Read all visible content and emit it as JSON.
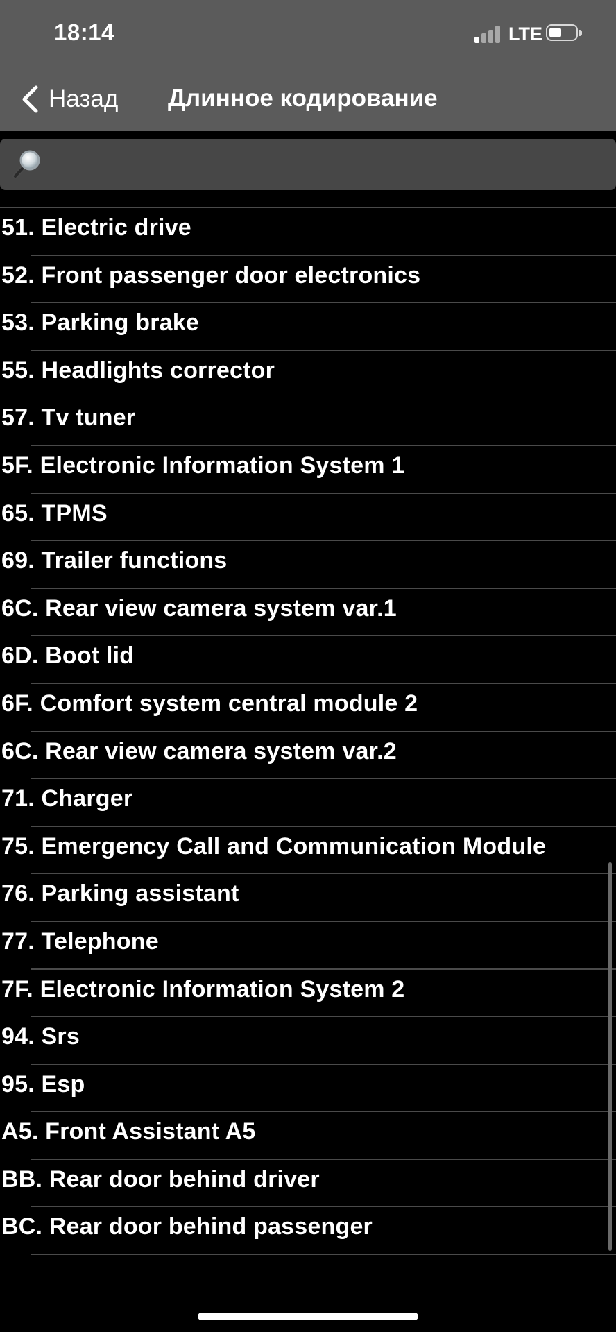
{
  "status_bar": {
    "time": "18:14",
    "network": "LTE",
    "signal_bars_active": 1,
    "signal_bars_total": 4,
    "battery_level": 0.45
  },
  "nav": {
    "back_label": "Назад",
    "back_icon": "chevron-left-icon",
    "title": "Длинное кодирование"
  },
  "search": {
    "icon": "magnifying-glass-icon",
    "value": "",
    "placeholder": ""
  },
  "list": {
    "items": [
      {
        "label": "51. Electric drive"
      },
      {
        "label": "52. Front passenger door electronics"
      },
      {
        "label": "53. Parking brake"
      },
      {
        "label": "55. Headlights corrector"
      },
      {
        "label": "57. Tv tuner"
      },
      {
        "label": "5F. Electronic Information System 1"
      },
      {
        "label": "65. TPMS"
      },
      {
        "label": "69. Trailer functions"
      },
      {
        "label": "6C. Rear view camera system var.1"
      },
      {
        "label": "6D. Boot lid"
      },
      {
        "label": "6F. Comfort system central module 2"
      },
      {
        "label": "6C. Rear view camera system var.2"
      },
      {
        "label": "71. Charger"
      },
      {
        "label": "75. Emergency Call and Communication Module"
      },
      {
        "label": "76. Parking assistant"
      },
      {
        "label": "77. Telephone"
      },
      {
        "label": "7F. Electronic Information System 2"
      },
      {
        "label": "94. Srs"
      },
      {
        "label": "95. Esp"
      },
      {
        "label": "A5. Front Assistant A5"
      },
      {
        "label": "BB. Rear door behind driver"
      },
      {
        "label": "BC. Rear door behind passenger"
      }
    ]
  },
  "colors": {
    "header_bg": "#5b5b5b",
    "search_bg": "#474747",
    "list_bg": "#000000",
    "separator": "#4a4a4a",
    "text": "#ffffff"
  }
}
